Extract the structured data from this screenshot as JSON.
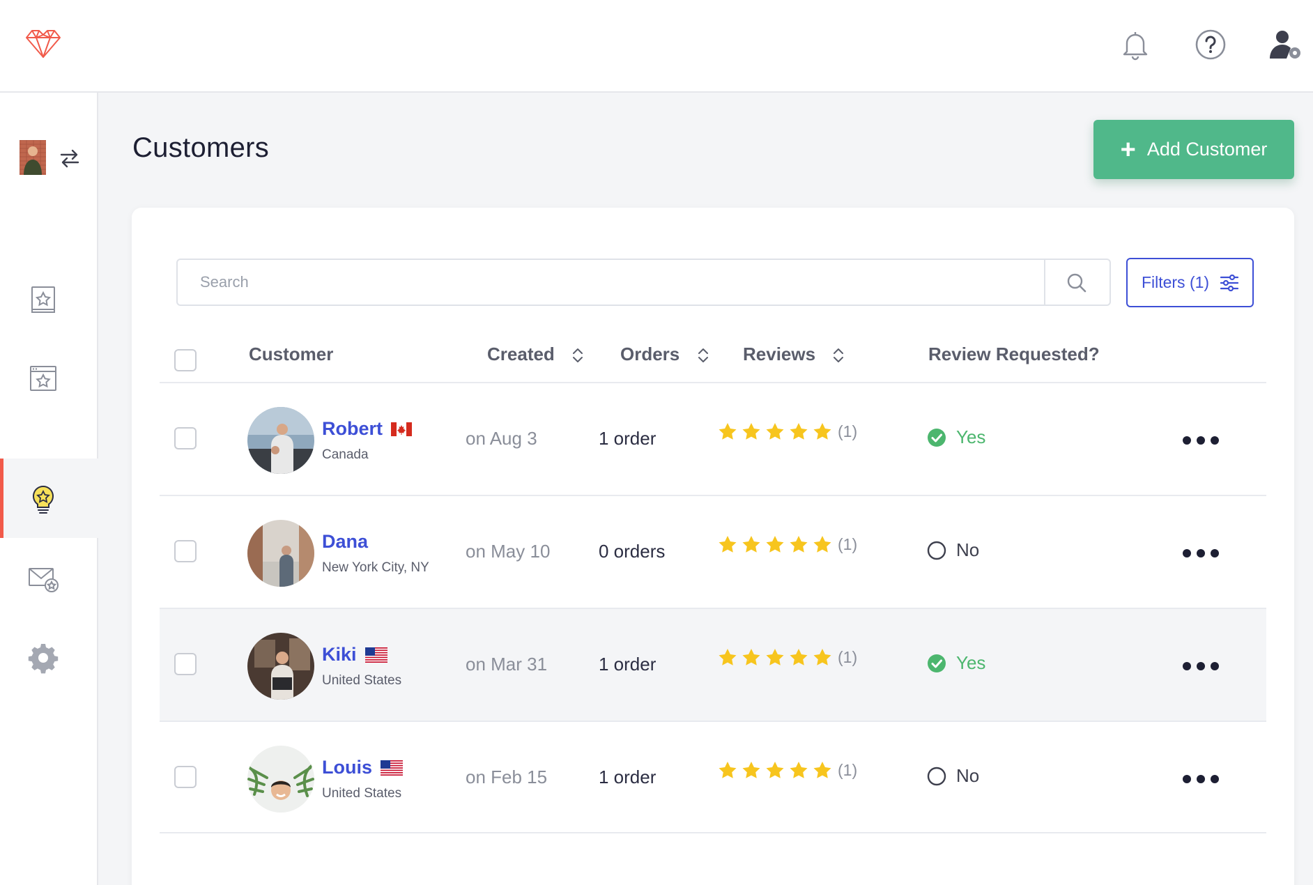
{
  "header": {
    "logo_icon": "heart-gem-logo-icon",
    "notifications_icon": "bell-icon",
    "help_icon": "help-circle-icon",
    "account_icon": "user-settings-icon"
  },
  "sidebar": {
    "account_switch_icon": "swap-arrows-icon",
    "items": [
      {
        "icon": "reviews-book-icon"
      },
      {
        "icon": "widget-window-icon"
      },
      {
        "icon": "lightbulb-star-icon",
        "active": true
      },
      {
        "icon": "mail-star-icon"
      },
      {
        "icon": "gear-icon"
      }
    ],
    "active_color": "#f15a4a"
  },
  "main": {
    "title": "Customers",
    "add_button_label": "Add Customer",
    "search_placeholder": "Search",
    "search_value": "",
    "filters_label": "Filters (1)"
  },
  "table": {
    "columns": {
      "customer": "Customer",
      "created": "Created",
      "orders": "Orders",
      "reviews": "Reviews",
      "review_requested": "Review Requested?"
    },
    "rows": [
      {
        "name": "Robert",
        "location": "Canada",
        "flag": "canada-flag-icon",
        "created": "on Aug 3",
        "orders": "1 order",
        "rating": 5,
        "review_count": "(1)",
        "requested": "Yes"
      },
      {
        "name": "Dana",
        "location": "New York City, NY",
        "flag": "",
        "created": "on May 10",
        "orders": "0 orders",
        "rating": 5,
        "review_count": "(1)",
        "requested": "No"
      },
      {
        "name": "Kiki",
        "location": "United States",
        "flag": "us-flag-icon",
        "created": "on Mar 31",
        "orders": "1 order",
        "rating": 5,
        "review_count": "(1)",
        "requested": "Yes"
      },
      {
        "name": "Louis",
        "location": "United States",
        "flag": "us-flag-icon",
        "created": "on Feb 15",
        "orders": "1 order",
        "rating": 5,
        "review_count": "(1)",
        "requested": "No"
      }
    ]
  },
  "colors": {
    "primary_blue": "#3d4fd6",
    "add_green": "#50b88a",
    "yes_green": "#4cb66e",
    "star_yellow": "#f7c51e"
  }
}
